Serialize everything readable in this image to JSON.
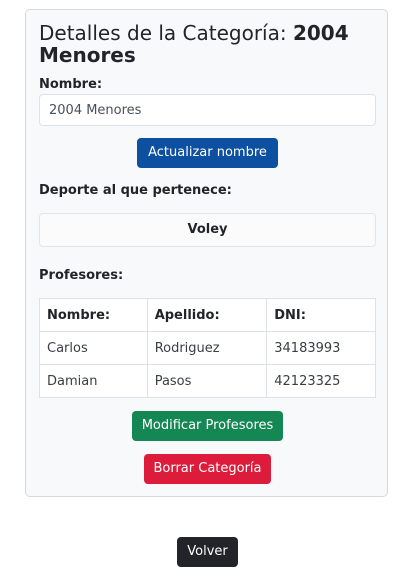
{
  "details": {
    "title_prefix": "Detalles de la Categoría: ",
    "category_name": "2004 Menores",
    "name_label": "Nombre:",
    "name_value": "2004 Menores",
    "update_button": "Actualizar nombre",
    "sport_label": "Deporte al que pertenece:",
    "sport_value": "Voley",
    "teachers_label": "Profesores:",
    "teachers_table": {
      "headers": [
        "Nombre:",
        "Apellido:",
        "DNI:"
      ],
      "rows": [
        [
          "Carlos",
          "Rodriguez",
          "34183993"
        ],
        [
          "Damian",
          "Pasos",
          "42123325"
        ]
      ]
    },
    "modify_teachers_button": "Modificar Profesores",
    "delete_button": "Borrar Categoría"
  },
  "back_button": "Volver",
  "colors": {
    "primary": "#0d4fa0",
    "success": "#158754",
    "danger": "#dc1c3a",
    "dark": "#212529"
  }
}
